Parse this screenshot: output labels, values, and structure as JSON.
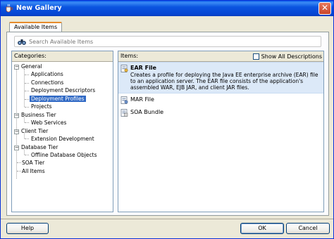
{
  "window": {
    "title": "New Gallery",
    "icon": "java-cup-icon",
    "close_icon": "close-icon",
    "close_glyph": "✕"
  },
  "tabs": [
    {
      "label": "Available Items"
    }
  ],
  "search": {
    "placeholder": "Search Available Items",
    "icon": "binoculars-icon"
  },
  "categories": {
    "header": "Categories:",
    "tree": [
      {
        "label": "General",
        "expanded": true
      },
      {
        "label": "Applications"
      },
      {
        "label": "Connections"
      },
      {
        "label": "Deployment Descriptors"
      },
      {
        "label": "Deployment Profiles",
        "selected": true
      },
      {
        "label": "Projects"
      },
      {
        "label": "Business Tier",
        "expanded": true
      },
      {
        "label": "Web Services"
      },
      {
        "label": "Client Tier",
        "expanded": true
      },
      {
        "label": "Extension Development"
      },
      {
        "label": "Database Tier",
        "expanded": true
      },
      {
        "label": "Offline Database Objects"
      },
      {
        "label": "SOA Tier"
      },
      {
        "label": "All Items"
      }
    ],
    "collapse_glyph": "−"
  },
  "items": {
    "header": "Items:",
    "show_all_label": "Show All Descriptions",
    "show_all_checked": false,
    "list": [
      {
        "name": "EAR File",
        "selected": true,
        "icon": "ear-file-icon",
        "description": "Creates a profile for deploying the Java EE enterprise archive (EAR) file to an application server.  The EAR file consists of the application's assembled WAR, EJB JAR, and client JAR files."
      },
      {
        "name": "MAR File",
        "icon": "mar-file-icon"
      },
      {
        "name": "SOA Bundle",
        "icon": "soa-bundle-icon"
      }
    ]
  },
  "buttons": {
    "help": "Help",
    "ok": "OK",
    "cancel": "Cancel"
  },
  "colors": {
    "titlebar": "#0a55e0",
    "selection": "#316ac5",
    "item_selected_bg": "#dce9f8",
    "tab_accent": "#e68b2c"
  }
}
